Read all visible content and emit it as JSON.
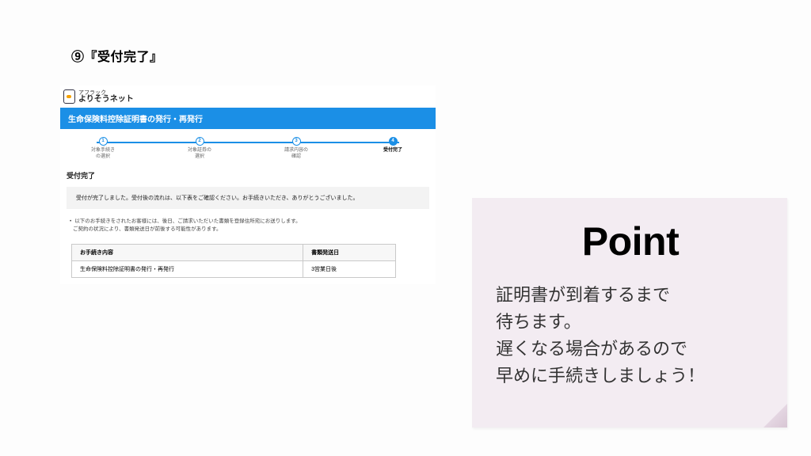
{
  "heading": "⑨『受付完了』",
  "brand": {
    "top": "アフラック",
    "bottom": "よりそうネット"
  },
  "blue_bar": "生命保険料控除証明書の発行・再発行",
  "steps": [
    {
      "num": "1",
      "label": "対象手続き\nの選択",
      "active": false
    },
    {
      "num": "2",
      "label": "対象証券の\n選択",
      "active": false
    },
    {
      "num": "3",
      "label": "請求内容の\n確認",
      "active": false
    },
    {
      "num": "4",
      "label": "受付完了",
      "active": true
    }
  ],
  "panel_title": "受付完了",
  "greybox": "受付が完了しました。受付後の流れは、以下表をご確認ください。お手続きいただき、ありがとうございました。",
  "bullets": [
    "以下のお手続きをされたお客様には、後日、ご請求いただいた書類を登録住所宛にお送りします。",
    "ご契約の状況により、書類発送日が前後する可能性があります。"
  ],
  "table": {
    "headers": [
      "お手続き内容",
      "書類発送日"
    ],
    "rows": [
      [
        "生命保険料控除証明書の発行・再発行",
        "3営業日後"
      ]
    ]
  },
  "note": {
    "title": "Point",
    "body": "証明書が到着するまで\n待ちます。\n遅くなる場合があるので\n早めに手続きしましょう！"
  }
}
